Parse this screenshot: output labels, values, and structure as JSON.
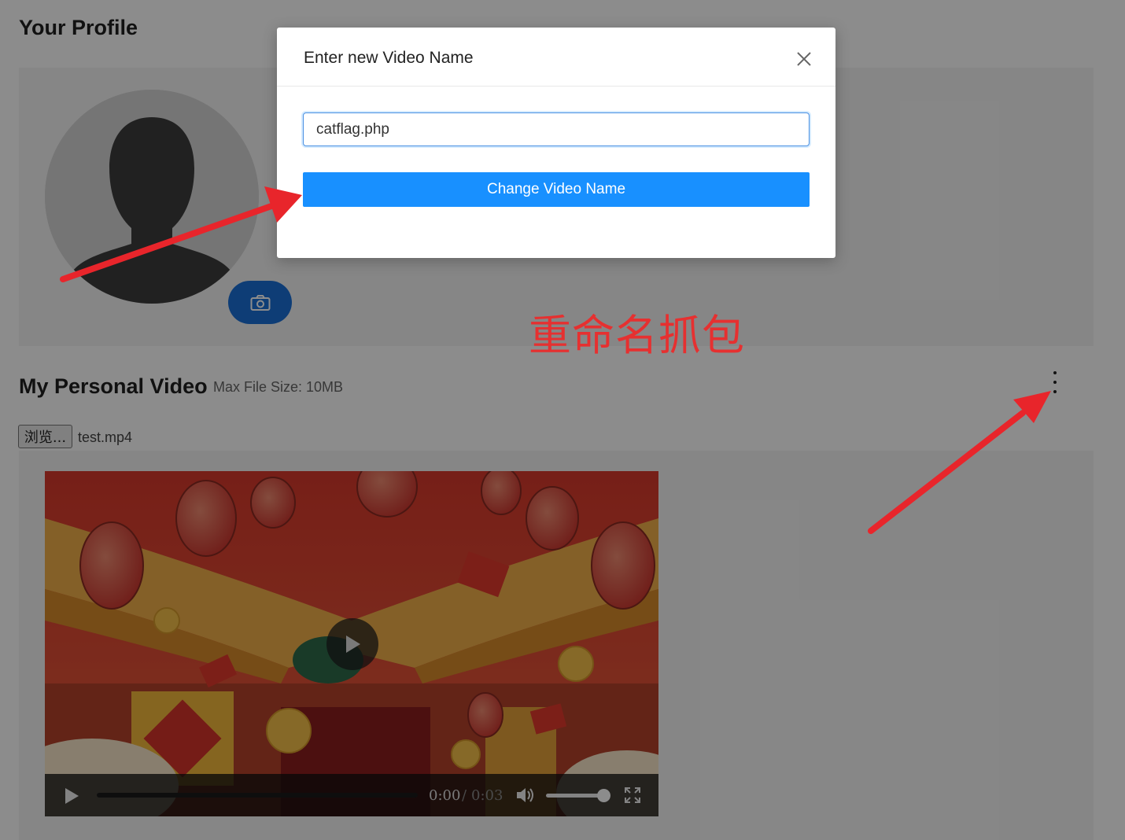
{
  "profile": {
    "title": "Your Profile",
    "avatar_icon": "user-silhouette-icon",
    "change_photo_icon": "camera-icon"
  },
  "video_section": {
    "title": "My Personal Video",
    "max_size": "Max File Size: 10MB",
    "menu_icon": "more-vertical-icon",
    "browse_label": "浏览...",
    "file_name": "test.mp4"
  },
  "player": {
    "current_time": "0:00",
    "separator": "/",
    "duration": "0:03",
    "progress": 0,
    "volume": 1.0
  },
  "modal": {
    "title": "Enter new Video Name",
    "input_value": "catflag.php",
    "submit_label": "Change Video Name",
    "close_icon": "close-icon"
  },
  "annotation": {
    "text": "重命名抓包",
    "color": "#e63030"
  },
  "colors": {
    "primary": "#1890ff",
    "camera_button": "#1a6fd8"
  }
}
